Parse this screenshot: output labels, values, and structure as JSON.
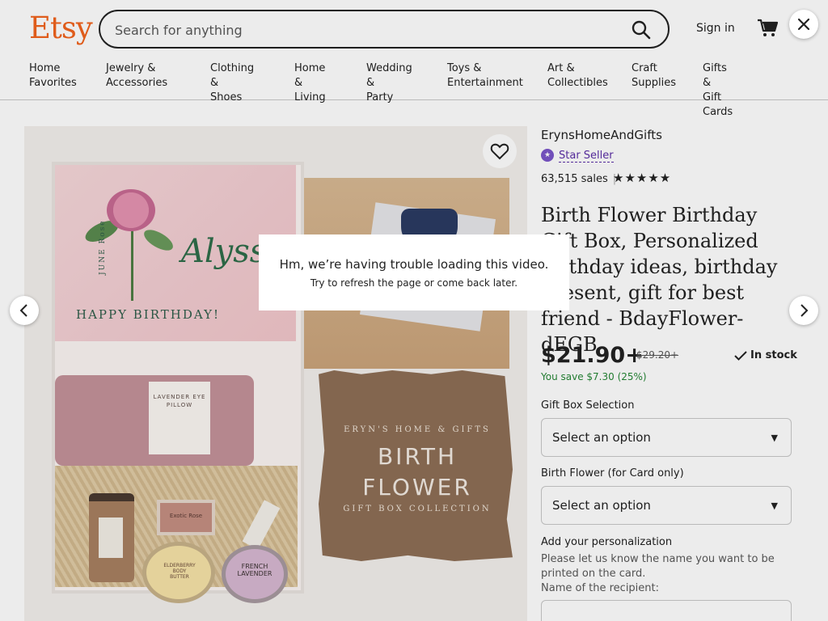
{
  "header": {
    "logo": "Etsy",
    "search_placeholder": "Search for anything",
    "sign_in": "Sign in"
  },
  "nav": [
    {
      "label": "Home\nFavorites"
    },
    {
      "label": "Jewelry &\nAccessories"
    },
    {
      "label": "Clothing &\nShoes"
    },
    {
      "label": "Home &\nLiving"
    },
    {
      "label": "Wedding &\nParty"
    },
    {
      "label": "Toys &\nEntertainment"
    },
    {
      "label": "Art &\nCollectibles"
    },
    {
      "label": "Craft\nSupplies"
    },
    {
      "label": "Gifts & Gift\nCards"
    }
  ],
  "photo_text": {
    "card_script": "Alyss",
    "card_month": "JUNE Rose",
    "card_greeting": "HAPPY BIRTHDAY!",
    "pillow": "LAVENDER EYE PILLOW",
    "soap": "Exotic Rose",
    "tin1": "ELDERBERRY BODY BUTTER",
    "tin2": "FRENCH LAVENDER",
    "kraft_top": "ERYN'S HOME & GIFTS",
    "kraft_main": "BIRTH\nFLOWER",
    "kraft_bottom": "GIFT BOX COLLECTION"
  },
  "product": {
    "shop_name": "ErynsHomeAndGifts",
    "star_seller": "Star Seller",
    "sales": "63,515 sales",
    "rating_stars": "★★★★★",
    "rating_value": 5,
    "title": "Birth Flower Birthday Gift Box, Personalized birthday ideas, birthday present, gift for best friend - BdayFlower-dEGB",
    "price": "$21.90+",
    "original_price": "$29.20+",
    "stock": "In stock",
    "savings": "You save $7.30 (25%)",
    "option1_label": "Gift Box Selection",
    "option1_value": "Select an option",
    "option2_label": "Birth Flower (for Card only)",
    "option2_value": "Select an option",
    "personalization_label": "Add your personalization",
    "personalization_help": "Please let us know the name you want to be printed on the card.\nName of the recipient:"
  },
  "video_error": {
    "title": "Hm, we’re having trouble loading this video.",
    "subtitle": "Try to refresh the page or come back later."
  },
  "colors": {
    "brand": "#f1641e",
    "star_seller": "#5a2ea6",
    "savings": "#258635"
  },
  "icons": {
    "search": "search-icon",
    "cart": "cart-icon",
    "favorite": "heart-icon",
    "prev": "chevron-left-icon",
    "next": "chevron-right-icon",
    "close": "close-icon",
    "check": "check-icon",
    "caret": "caret-down-icon"
  }
}
